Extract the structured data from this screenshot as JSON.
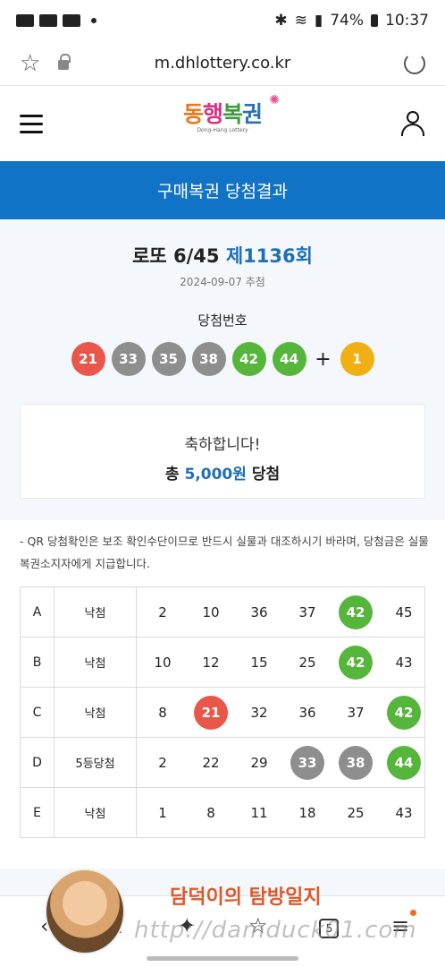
{
  "status_bar": {
    "battery": "74%",
    "time": "10:37"
  },
  "browser": {
    "url": "m.dhlottery.co.kr"
  },
  "site": {
    "logo_text": [
      "동",
      "행",
      "복",
      "권"
    ],
    "logo_sub": "Dong-Hang Lottery",
    "banner_title": "구매복권 당첨결과"
  },
  "draw": {
    "game": "로또 6/45",
    "round": "제1136회",
    "date": "2024-09-07 추첨",
    "winning_label": "당첨번호",
    "numbers": [
      {
        "value": "21",
        "color": "#e8574a"
      },
      {
        "value": "33",
        "color": "#8e8e8e"
      },
      {
        "value": "35",
        "color": "#8e8e8e"
      },
      {
        "value": "38",
        "color": "#8e8e8e"
      },
      {
        "value": "42",
        "color": "#56b53b"
      },
      {
        "value": "44",
        "color": "#56b53b"
      }
    ],
    "plus": "+",
    "bonus": {
      "value": "1",
      "color": "#f0b014"
    }
  },
  "summary": {
    "congrats": "축하합니다!",
    "total_prefix": "총",
    "amount": "5,000원",
    "total_suffix": "당첨"
  },
  "notice": "- QR 당첨확인은 보조 확인수단이므로 반드시 실물과 대조하시기 바라며, 당첨금은 실물 복권소지자에게 지급합니다.",
  "tickets": [
    {
      "label": "A",
      "result": "낙첨",
      "nums": [
        {
          "v": "2"
        },
        {
          "v": "10"
        },
        {
          "v": "36"
        },
        {
          "v": "37"
        },
        {
          "v": "42",
          "hit": "#56b53b"
        },
        {
          "v": "45"
        }
      ]
    },
    {
      "label": "B",
      "result": "낙첨",
      "nums": [
        {
          "v": "10"
        },
        {
          "v": "12"
        },
        {
          "v": "15"
        },
        {
          "v": "25"
        },
        {
          "v": "42",
          "hit": "#56b53b"
        },
        {
          "v": "43"
        }
      ]
    },
    {
      "label": "C",
      "result": "낙첨",
      "nums": [
        {
          "v": "8"
        },
        {
          "v": "21",
          "hit": "#e8574a"
        },
        {
          "v": "32"
        },
        {
          "v": "36"
        },
        {
          "v": "37"
        },
        {
          "v": "42",
          "hit": "#56b53b"
        }
      ]
    },
    {
      "label": "D",
      "result": "5등당첨",
      "nums": [
        {
          "v": "2"
        },
        {
          "v": "22"
        },
        {
          "v": "29"
        },
        {
          "v": "33",
          "hit": "#8e8e8e"
        },
        {
          "v": "38",
          "hit": "#8e8e8e"
        },
        {
          "v": "44",
          "hit": "#56b53b"
        }
      ]
    },
    {
      "label": "E",
      "result": "낙첨",
      "nums": [
        {
          "v": "1"
        },
        {
          "v": "8"
        },
        {
          "v": "11"
        },
        {
          "v": "18"
        },
        {
          "v": "25"
        },
        {
          "v": "43"
        }
      ]
    }
  ],
  "bottom_nav": {
    "tab_count": "5"
  },
  "watermark": {
    "title": "담덕이의 탐방일지",
    "url": "http://damduck01.com"
  }
}
